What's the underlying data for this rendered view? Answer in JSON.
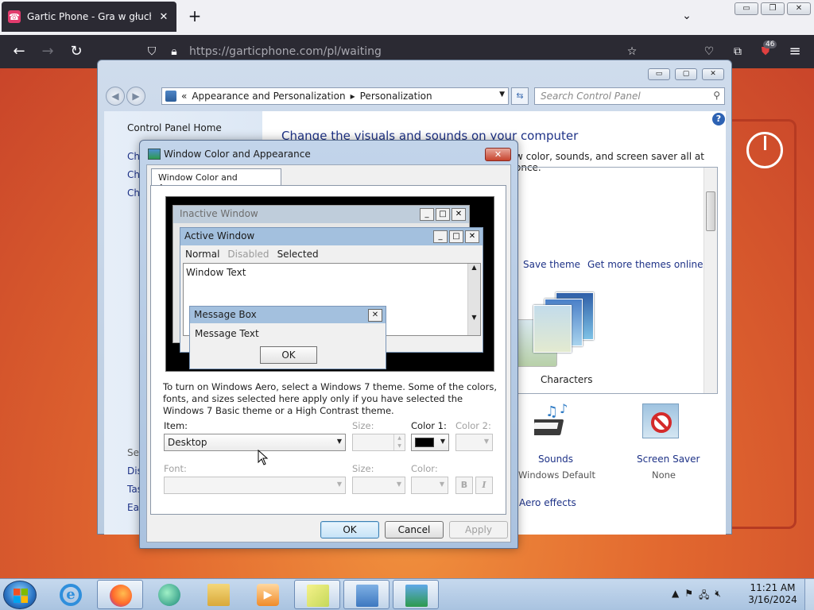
{
  "browser": {
    "tab_title": "Gartic Phone - Gra w głuchy tel",
    "tab_close": "✕",
    "new_tab": "+",
    "tab_list": "⌄",
    "url": "https://garticphone.com/pl/waiting",
    "extension_badge": "46",
    "window_controls": [
      "▭",
      "❐",
      "✕"
    ]
  },
  "control_panel": {
    "window_controls": [
      "▭",
      "▢",
      "✕"
    ],
    "breadcrumb": [
      "«",
      "Appearance and Personalization",
      "▸",
      "Personalization"
    ],
    "search_placeholder": "Search Control Panel",
    "sidebar": {
      "home": "Control Panel Home",
      "links": [
        "Ch",
        "Ch",
        "Ch"
      ],
      "see_also": "See",
      "more_links": [
        "Dis",
        "Tas",
        "Eas"
      ]
    },
    "main": {
      "title": "Change the visuals and sounds on your computer",
      "subtitle": "w color, sounds, and screen saver all at once.",
      "save_theme": "Save theme",
      "more_themes": "Get more themes online",
      "theme_name": "Characters",
      "sounds_label": "Sounds",
      "sounds_value": "Windows Default",
      "saver_label": "Screen Saver",
      "saver_value": "None",
      "aero_link": "Aero effects"
    }
  },
  "dialog": {
    "title": "Window Color and Appearance",
    "tab": "Window Color and Appearance",
    "preview": {
      "inactive_title": "Inactive Window",
      "active_title": "Active Window",
      "menu_normal": "Normal",
      "menu_disabled": "Disabled",
      "menu_selected": "Selected",
      "window_text": "Window Text",
      "msg_title": "Message Box",
      "msg_text": "Message Text",
      "msg_ok": "OK"
    },
    "description": "To turn on Windows Aero, select a Windows 7 theme.  Some of the colors, fonts, and sizes selected here apply only if you have selected the Windows 7 Basic theme or a High Contrast theme.",
    "labels": {
      "item": "Item:",
      "size": "Size:",
      "color1": "Color 1:",
      "color2": "Color 2:",
      "font": "Font:",
      "font_size": "Size:",
      "font_color": "Color:"
    },
    "item_value": "Desktop",
    "bold": "B",
    "italic": "I",
    "buttons": {
      "ok": "OK",
      "cancel": "Cancel",
      "apply": "Apply"
    }
  },
  "taskbar": {
    "time": "11:21 AM",
    "date": "3/16/2024"
  },
  "colors": {
    "page_orange": "#e2682f",
    "browser_dark": "#2b2a33",
    "aero_blue": "#a3c0de",
    "link_blue": "#1e3287"
  }
}
